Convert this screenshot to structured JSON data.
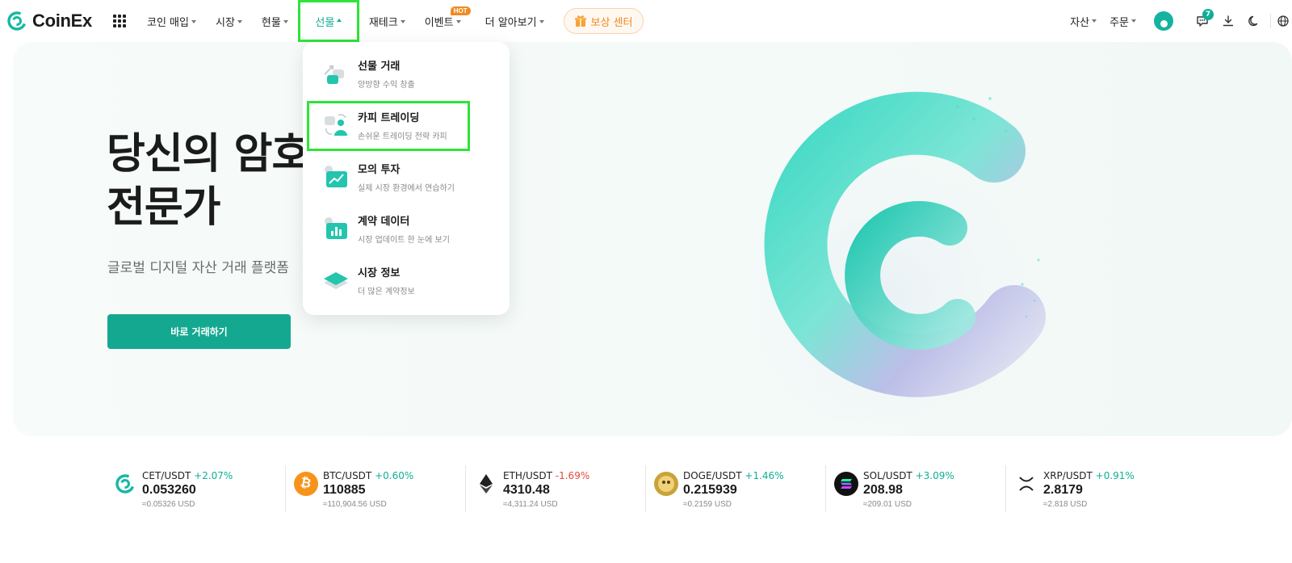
{
  "brand": {
    "name": "CoinEx",
    "accent": "#15a890"
  },
  "nav": {
    "items": [
      {
        "label": "코인 매입"
      },
      {
        "label": "시장"
      },
      {
        "label": "현물"
      },
      {
        "label": "선물"
      },
      {
        "label": "재테크"
      },
      {
        "label": "이벤트",
        "badge": "HOT"
      },
      {
        "label": "더 알아보기"
      }
    ],
    "reward_label": "보상 센터"
  },
  "header_right": {
    "assets_label": "자산",
    "orders_label": "주문",
    "notification_count": "7"
  },
  "hero": {
    "title_line1": "당신의 암호",
    "title_line2": "전문가",
    "subtitle": "글로벌 디지털 자산 거래 플랫폼",
    "cta_label": "바로 거래하기"
  },
  "dropdown": {
    "items": [
      {
        "title": "선물 거래",
        "desc": "양방향 수익 창출",
        "icon": "futures-trade-icon"
      },
      {
        "title": "카피 트레이딩",
        "desc": "손쉬운 트레이딩 전략 카피",
        "icon": "copy-trading-icon"
      },
      {
        "title": "모의 투자",
        "desc": "실제 시장 환경에서 연습하기",
        "icon": "demo-trading-icon"
      },
      {
        "title": "계약 데이터",
        "desc": "시장 업데이트 한 눈에 보기",
        "icon": "contract-data-icon"
      },
      {
        "title": "시장 정보",
        "desc": "더 많은 계약정보",
        "icon": "market-info-icon"
      }
    ]
  },
  "ticker": [
    {
      "pair": "CET/USDT",
      "change": "+2.07%",
      "price": "0.053260",
      "usd": "≈0.05326 USD",
      "dir": "up"
    },
    {
      "pair": "BTC/USDT",
      "change": "+0.60%",
      "price": "110885",
      "usd": "≈110,904.56 USD",
      "dir": "up"
    },
    {
      "pair": "ETH/USDT",
      "change": "-1.69%",
      "price": "4310.48",
      "usd": "≈4,311.24 USD",
      "dir": "down"
    },
    {
      "pair": "DOGE/USDT",
      "change": "+1.46%",
      "price": "0.215939",
      "usd": "≈0.2159 USD",
      "dir": "up"
    },
    {
      "pair": "SOL/USDT",
      "change": "+3.09%",
      "price": "208.98",
      "usd": "≈209.01 USD",
      "dir": "up"
    },
    {
      "pair": "XRP/USDT",
      "change": "+0.91%",
      "price": "2.8179",
      "usd": "≈2.818 USD",
      "dir": "up"
    }
  ]
}
